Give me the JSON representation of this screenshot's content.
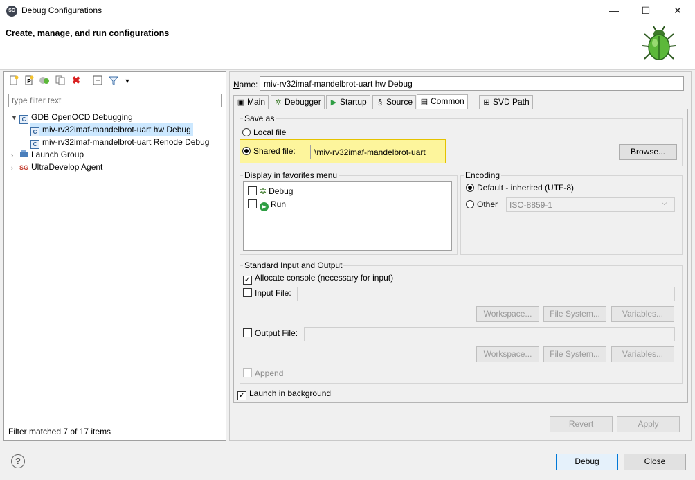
{
  "window": {
    "title": "Debug Configurations",
    "app_badge": "SC",
    "minimize_glyph": "—",
    "maximize_glyph": "☐",
    "close_glyph": "✕"
  },
  "banner": {
    "title": "Create, manage, and run configurations",
    "icon": "bug-icon"
  },
  "toolbar": {
    "icons": [
      "new-config-icon",
      "new-prototype-icon",
      "export-icon",
      "duplicate-icon",
      "delete-icon",
      "collapse-all-icon",
      "filter-icon",
      "view-menu-icon"
    ]
  },
  "filter": {
    "placeholder": "type filter text",
    "status": "Filter matched 7 of 17 items"
  },
  "tree": {
    "groups": [
      {
        "label": "GDB OpenOCD Debugging",
        "expanded": true,
        "children": [
          {
            "label": "miv-rv32imaf-mandelbrot-uart hw Debug",
            "selected": true
          },
          {
            "label": "miv-rv32imaf-mandelbrot-uart Renode Debug",
            "selected": false
          }
        ]
      },
      {
        "label": "Launch Group",
        "expanded": false
      },
      {
        "label": "UltraDevelop Agent",
        "expanded": false
      }
    ]
  },
  "name": {
    "label": "Name:",
    "value": "miv-rv32imaf-mandelbrot-uart hw Debug"
  },
  "tabs": [
    {
      "label": "Main",
      "icon": "main-tab-icon",
      "active": false
    },
    {
      "label": "Debugger",
      "icon": "debugger-tab-icon",
      "active": false
    },
    {
      "label": "Startup",
      "icon": "startup-tab-icon",
      "active": false
    },
    {
      "label": "Source",
      "icon": "source-tab-icon",
      "active": false
    },
    {
      "label": "Common",
      "icon": "common-tab-icon",
      "active": true
    },
    {
      "label": "SVD Path",
      "icon": "svd-tab-icon",
      "active": false
    }
  ],
  "save_as": {
    "legend": "Save as",
    "local_file_label": "Local file",
    "shared_file_label": "Shared file:",
    "shared_file_value": "\\miv-rv32imaf-mandelbrot-uart",
    "browse_label": "Browse...",
    "highlight_color": "#fdf59c",
    "highlight_border": "#e4c200"
  },
  "favorites": {
    "legend": "Display in favorites menu",
    "items": [
      {
        "label": "Debug",
        "checked": false,
        "icon": "debug-icon"
      },
      {
        "label": "Run",
        "checked": false,
        "icon": "run-icon"
      }
    ]
  },
  "encoding": {
    "legend": "Encoding",
    "default_label": "Default - inherited (UTF-8)",
    "other_label": "Other",
    "other_value": "ISO-8859-1"
  },
  "std_io": {
    "legend": "Standard Input and Output",
    "allocate_console_label": "Allocate console (necessary for input)",
    "input_file_label": "Input File:",
    "output_file_label": "Output File:",
    "workspace_label": "Workspace...",
    "file_system_label": "File System...",
    "variables_label": "Variables...",
    "append_label": "Append"
  },
  "launch_background_label": "Launch in background",
  "actions": {
    "revert_label": "Revert",
    "apply_label": "Apply"
  },
  "footer": {
    "help_glyph": "?",
    "debug_label": "Debug",
    "close_label": "Close"
  },
  "colors": {
    "selection": "#cce8ff",
    "run_green": "#2f9e44",
    "delete_red": "#d92121",
    "accent_blue": "#3c6fa8"
  }
}
